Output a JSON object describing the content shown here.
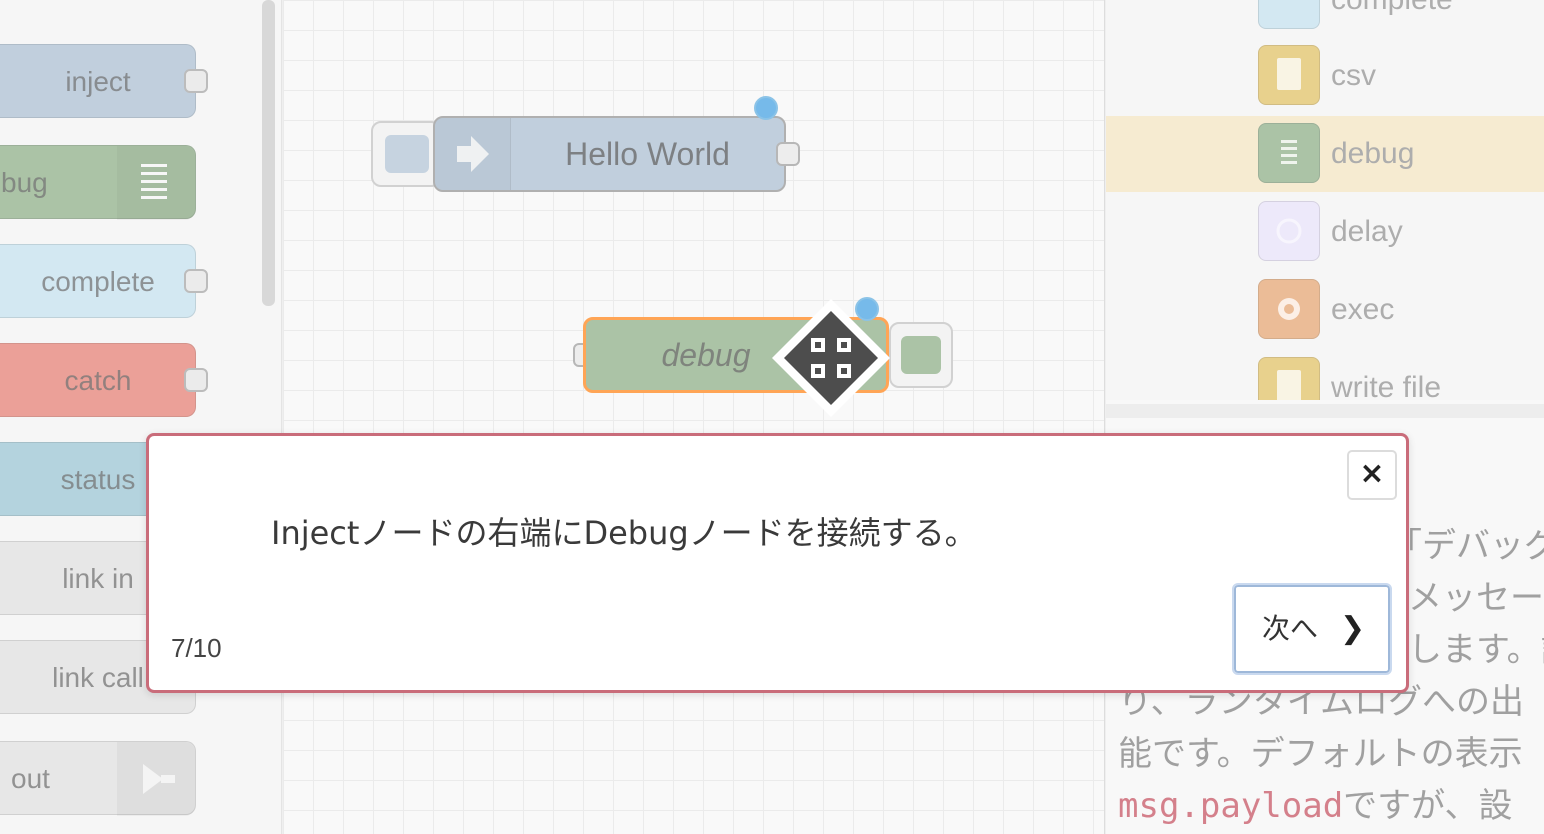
{
  "palette": {
    "nodes": [
      {
        "label": "inject",
        "color": "#a6bbcf",
        "has_port": true
      },
      {
        "label": "bug",
        "color": "#87a980",
        "has_port": false,
        "icon": "list-icon"
      },
      {
        "label": "complete",
        "color": "#c0deed",
        "has_port": true
      },
      {
        "label": "catch",
        "color": "#e2786c",
        "has_port": true
      },
      {
        "label": "status",
        "color": "#94c1d0",
        "has_port": false
      },
      {
        "label": "link in",
        "color": "#dddddd",
        "has_port": false
      },
      {
        "label": "link call",
        "color": "#dddddd",
        "has_port": false
      },
      {
        "label": "out",
        "color": "#dddddd",
        "has_port": false,
        "icon": "link-out-icon"
      }
    ]
  },
  "canvas": {
    "hello_node": {
      "label": "Hello World",
      "color": "#a6bbcf",
      "icon": "inject-arrow-icon"
    },
    "debug_node": {
      "label": "debug",
      "color": "#87a980",
      "selected_border": "#ff7f0e"
    },
    "cursor": "move-cursor-icon"
  },
  "sidebar": {
    "items": [
      {
        "label": "complete",
        "color": "#c0deed"
      },
      {
        "label": "csv",
        "color": "#debd5c"
      },
      {
        "label": "debug",
        "color": "#87a980",
        "selected": true
      },
      {
        "label": "delay",
        "color": "#e6e0f8"
      },
      {
        "label": "exec",
        "color": "#e2a06a"
      },
      {
        "label": "write file",
        "color": "#debd5c"
      }
    ],
    "info_lines": [
      "「デバッグ」",
      "メッセージフ",
      "します。設",
      "り、ランタイムログへの出",
      "能です。デフォルトの表示"
    ],
    "info_code": "msg.payload",
    "info_code_tail": "ですが、設"
  },
  "tour": {
    "message": "Injectノードの右端にDebugノードを接続する。",
    "step": "7/10",
    "next_label": "次へ",
    "next_icon": "chevron-right-icon",
    "close_label": "×",
    "border_color": "#c96c7a"
  }
}
